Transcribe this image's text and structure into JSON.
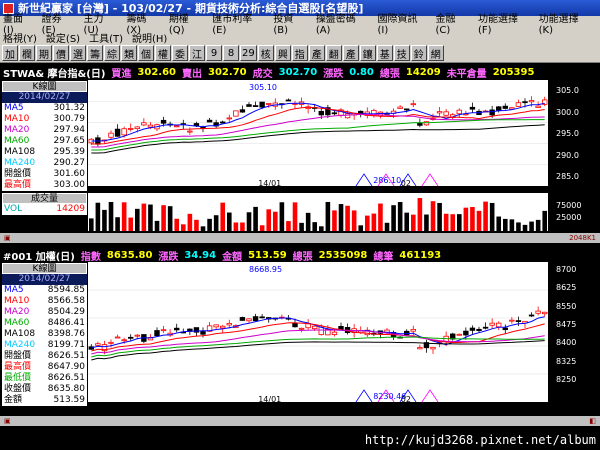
{
  "window": {
    "title": "新世紀贏家 [台灣] - 103/02/27 - 期貨技術分析:綜合自選股[名望股]"
  },
  "menu": {
    "row1": [
      "畫面(I)",
      "證券(E)",
      "主力(U)",
      "籌碼(X)",
      "期權(Q)",
      "匯市利率(E)",
      "投資(B)",
      "操盤密碼(A)",
      "國際資訊(I)",
      "金融(C)",
      "功能選擇(F)",
      "功能選擇(K)"
    ],
    "row2": [
      "格視(Y)",
      "設定(S)",
      "工具(T)",
      "說明(H)"
    ]
  },
  "toolbar": {
    "buttons": [
      "加",
      "欄",
      "期",
      "價",
      "選",
      "籌",
      "綜",
      "類",
      "個",
      "權",
      "委",
      "江",
      "9",
      "8",
      "29",
      "核",
      "興",
      "指",
      "產",
      "翻",
      "產",
      "鑲",
      "基",
      "技",
      "鈴",
      "網"
    ]
  },
  "panel1": {
    "symbol": "STWA& 摩台指&(日)",
    "buy_label": "買進",
    "buy_value": "302.60",
    "sell_label": "賣出",
    "sell_value": "302.70",
    "deal_label": "成交",
    "deal_value": "302.70",
    "change_label": "漲跌",
    "change_value": "0.80",
    "volume_label": "總張",
    "volume_value": "14209",
    "oi_label": "未平倉量",
    "oi_value": "205395",
    "legend_title": "K線圖",
    "legend_date": "2014/02/27",
    "legend_rows": [
      {
        "name": "MA5",
        "value": "301.32",
        "color": "#0000ff"
      },
      {
        "name": "MA10",
        "value": "300.79",
        "color": "#ff0000"
      },
      {
        "name": "MA20",
        "value": "297.94",
        "color": "#cc00cc"
      },
      {
        "name": "MA60",
        "value": "297.65",
        "color": "#00aa00"
      },
      {
        "name": "MA108",
        "value": "295.39",
        "color": "#000000"
      },
      {
        "name": "MA240",
        "value": "290.27",
        "color": "#00ccff"
      },
      {
        "name": "開盤價",
        "value": "301.60",
        "color": "#000000"
      },
      {
        "name": "最高價",
        "value": "303.00",
        "color": "#ff0000"
      }
    ],
    "high_label": "305.10",
    "low_label": "286.10",
    "scale": [
      "305.0",
      "300.0",
      "295.0",
      "290.0",
      "285.0"
    ],
    "xlabels": [
      "14/01",
      "02"
    ],
    "vol_title": "成交量",
    "vol_name": "VOL",
    "vol_value": "14209",
    "vol_scale": [
      "75000",
      "25000"
    ],
    "status": "2048K1"
  },
  "panel2": {
    "symbol": "#001 加權(日)",
    "index_label": "指數",
    "index_value": "8635.80",
    "change_label": "漲跌",
    "change_value": "34.94",
    "amount_label": "金額",
    "amount_value": "513.59",
    "vol_label": "總張",
    "vol_value": "2535098",
    "count_label": "總筆",
    "count_value": "461193",
    "legend_title": "K線圖",
    "legend_date": "2014/02/27",
    "legend_rows": [
      {
        "name": "MA5",
        "value": "8594.85",
        "color": "#0000ff"
      },
      {
        "name": "MA10",
        "value": "8566.58",
        "color": "#ff0000"
      },
      {
        "name": "MA20",
        "value": "8504.29",
        "color": "#cc00cc"
      },
      {
        "name": "MA60",
        "value": "8486.41",
        "color": "#00aa00"
      },
      {
        "name": "MA108",
        "value": "8398.76",
        "color": "#000000"
      },
      {
        "name": "MA240",
        "value": "8199.71",
        "color": "#00ccff"
      },
      {
        "name": "開盤價",
        "value": "8626.51",
        "color": "#000000"
      },
      {
        "name": "最高價",
        "value": "8647.90",
        "color": "#ff0000"
      },
      {
        "name": "最低價",
        "value": "8626.51",
        "color": "#00aa00"
      },
      {
        "name": "收盤價",
        "value": "8635.80",
        "color": "#000000"
      },
      {
        "name": "金額",
        "value": "513.59",
        "color": "#000000"
      }
    ],
    "high_label": "8668.95",
    "low_label": "8230.46",
    "scale": [
      "8700",
      "8625",
      "8550",
      "8475",
      "8400",
      "8325",
      "8250"
    ],
    "xlabels": [
      "14/01",
      "02"
    ]
  },
  "footer": {
    "url": "http://kujd3268.pixnet.net/album"
  }
}
